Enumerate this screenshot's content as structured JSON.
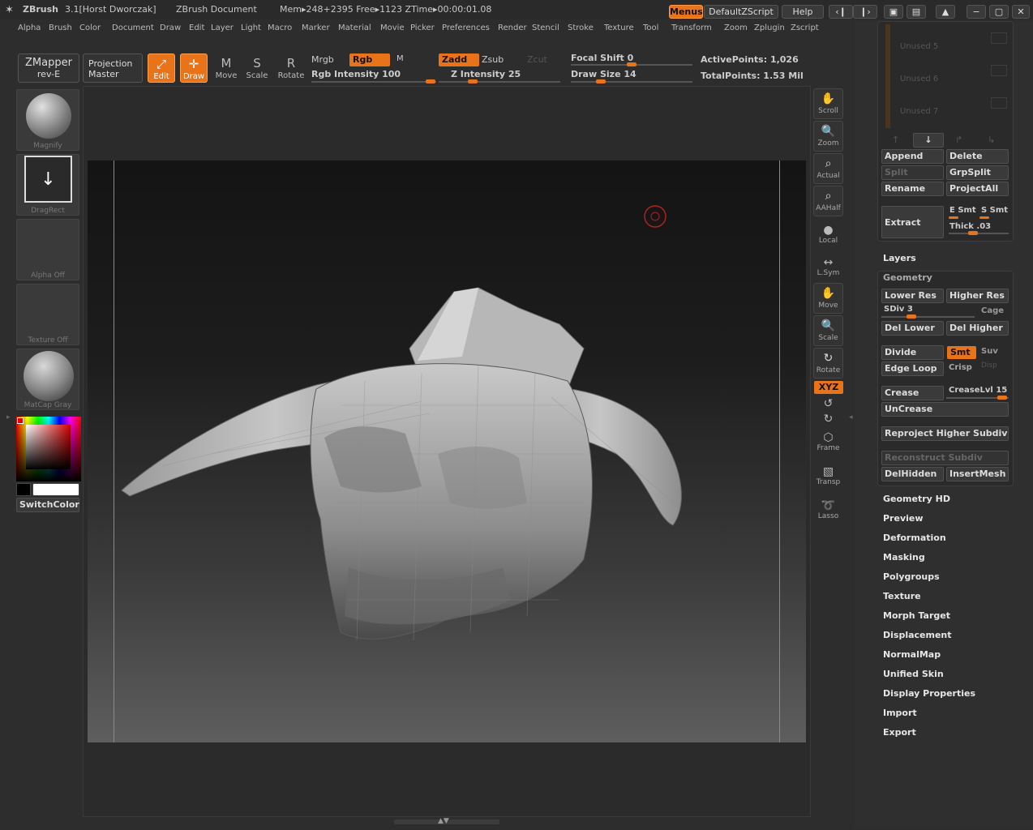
{
  "titlebar": {
    "app": "ZBrush",
    "version": "3.1[Horst Dworczak]",
    "document": "ZBrush Document",
    "mem": "Mem▸248+2395  Free▸1123  ZTime▸00:00:01.08",
    "menus_btn": "Menus",
    "script_btn": "DefaultZScript",
    "help_btn": "Help"
  },
  "menubar": [
    "Alpha",
    "Brush",
    "Color",
    "Document",
    "Draw",
    "Edit",
    "Layer",
    "Light",
    "Macro",
    "Marker",
    "Material",
    "Movie",
    "Picker",
    "Preferences",
    "Render",
    "Stencil",
    "Stroke",
    "Texture",
    "Tool",
    "Transform",
    "Zoom",
    "Zplugin",
    "Zscript"
  ],
  "toolbar": {
    "zmapper": "ZMapper",
    "zmapper_sub": "rev-E",
    "projection": "Projection",
    "projection_sub": "Master",
    "edit": "Edit",
    "draw": "Draw",
    "move": "Move",
    "scale": "Scale",
    "rotate": "Rotate",
    "mrgb": "Mrgb",
    "rgb": "Rgb",
    "m": "M",
    "rgb_intensity": "Rgb Intensity 100",
    "zadd": "Zadd",
    "zsub": "Zsub",
    "zcut": "Zcut",
    "z_intensity": "Z Intensity 25",
    "focal_shift": "Focal Shift 0",
    "draw_size": "Draw Size 14",
    "active_points": "ActivePoints: 1,026",
    "total_points": "TotalPoints: 1.53 Mil",
    "rgb_intensity_value": 100,
    "z_intensity_value": 25
  },
  "leftshelf": {
    "brush": "Magnify",
    "stroke": "DragRect",
    "alpha": "Alpha  Off",
    "texture": "Texture  Off",
    "material": "MatCap  Gray",
    "switch": "SwitchColor"
  },
  "rightshelf": {
    "scroll": "Scroll",
    "zoom": "Zoom",
    "actual": "Actual",
    "aahalf": "AAHalf",
    "local": "Local",
    "lsym": "L.Sym",
    "move": "Move",
    "scale": "Scale",
    "rotate": "Rotate",
    "xyz": "XYZ",
    "frame": "Frame",
    "transp": "Transp",
    "lasso": "Lasso"
  },
  "tray": {
    "unused": [
      "Unused 5",
      "Unused 6",
      "Unused 7"
    ],
    "append": "Append",
    "delete": "Delete",
    "split": "Split",
    "grpsplit": "GrpSplit",
    "rename": "Rename",
    "projectall": "ProjectAll",
    "extract": "Extract",
    "esmt": "E Smt",
    "ssmt": "S Smt",
    "thick": "Thick .03",
    "layers": "Layers",
    "geometry": "Geometry",
    "lower_res": "Lower Res",
    "higher_res": "Higher Res",
    "sdiv": "SDiv 3",
    "cage": "Cage",
    "del_lower": "Del Lower",
    "del_higher": "Del Higher",
    "divide": "Divide",
    "smt": "Smt",
    "suv": "Suv",
    "edge_loop": "Edge Loop",
    "crisp": "Crisp",
    "disp": "Disp",
    "crease": "Crease",
    "creaselvl": "CreaseLvl 15",
    "uncrease": "UnCrease",
    "reproject": "Reproject Higher Subdiv",
    "reconstruct": "Reconstruct Subdiv",
    "delhidden": "DelHidden",
    "insertmesh": "InsertMesh",
    "sections": [
      "Geometry HD",
      "Preview",
      "Deformation",
      "Masking",
      "Polygroups",
      "Texture",
      "Morph Target",
      "Displacement",
      "NormalMap",
      "Unified Skin",
      "Display Properties",
      "Import",
      "Export"
    ]
  },
  "colors": {
    "accent": "#e87318",
    "bg": "#2d2d2d",
    "panel": "#2a2a2a"
  }
}
